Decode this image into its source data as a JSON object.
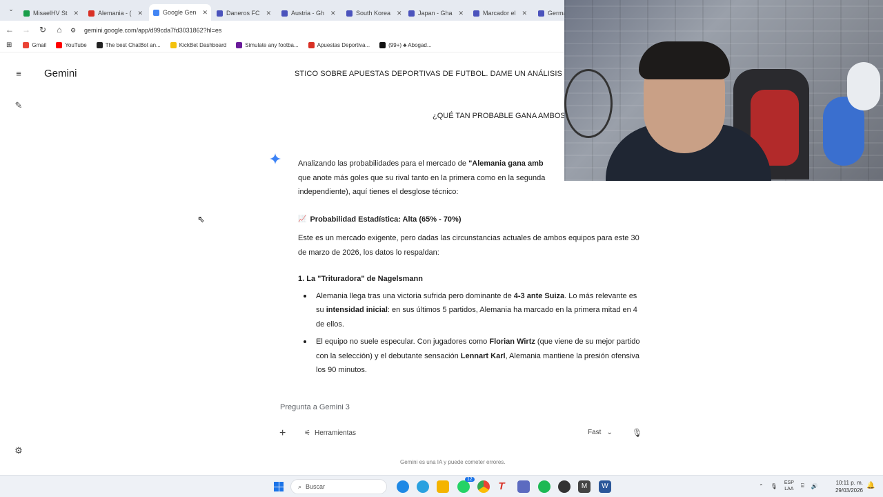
{
  "browser": {
    "tabs": [
      {
        "label": "MisaelHV St",
        "color": "#1a9e4a"
      },
      {
        "label": "Alemania - (",
        "color": "#d93025"
      },
      {
        "label": "Google Gen",
        "color": "#4285f4",
        "active": true
      },
      {
        "label": "Daneros FC",
        "color": "#4b53bc"
      },
      {
        "label": "Austria - Gh",
        "color": "#4b53bc"
      },
      {
        "label": "South Korea",
        "color": "#4b53bc"
      },
      {
        "label": "Japan - Gha",
        "color": "#4b53bc"
      },
      {
        "label": "Marcador el",
        "color": "#4b53bc"
      },
      {
        "label": "Germany",
        "color": "#4b53bc"
      }
    ],
    "url": "gemini.google.com/app/d99cda7fd3031862?hl=es",
    "bookmarks": [
      {
        "label": "Gmail",
        "color": "#ea4335"
      },
      {
        "label": "YouTube",
        "color": "#ff0000"
      },
      {
        "label": "The best ChatBot an...",
        "color": "#222222"
      },
      {
        "label": "KickBet Dashboard",
        "color": "#f4c20d"
      },
      {
        "label": "Simulate any footba...",
        "color": "#6a1b9a"
      },
      {
        "label": "Apuestas Deportiva...",
        "color": "#d93025"
      },
      {
        "label": "(99+) ♣ Abogad...",
        "color": "#111111"
      }
    ]
  },
  "app": {
    "brand": "Gemini"
  },
  "conversation": {
    "user_prompt_1": "STICO SOBRE APUESTAS DEPORTIVAS DE FUTBOL. DAME UN ANÁLISIS",
    "user_prompt_2": "¿QUÉ TAN PROBABLE GANA AMBOS",
    "response": {
      "intro_a": "Analizando las probabilidades para el mercado de ",
      "intro_b": "\"Alemania gana amb",
      "intro_c": "que anote más goles que su rival tanto en la primera como en la segunda",
      "intro_d": "independiente), aquí tienes el desglose técnico:",
      "stat_icon": "📈",
      "stat_heading": "Probabilidad Estadística: Alta (65% - 70%)",
      "para2": "Este es un mercado exigente, pero dadas las circunstancias actuales de ambos equipos para este 30 de marzo de 2026, los datos lo respaldan:",
      "section1": "1. La \"Trituradora\" de Nagelsmann",
      "b1_a": "Alemania llega tras una victoria sufrida pero dominante de ",
      "b1_b": "4-3 ante Suiza",
      "b1_c": ". Lo más relevante es su ",
      "b1_d": "intensidad inicial",
      "b1_e": ": en sus últimos 5 partidos, Alemania ha marcado en la primera mitad en 4 de ellos.",
      "b2_a": "El equipo no suele especular. Con jugadores como ",
      "b2_b": "Florian Wirtz",
      "b2_c": " (que viene de su mejor partido con la selección) y el debutante sensación ",
      "b2_d": "Lennart Karl",
      "b2_e": ", Alemania mantiene la presión ofensiva los 90 minutos."
    }
  },
  "input": {
    "placeholder": "Pregunta a Gemini 3",
    "tools_label": "Herramientas",
    "model_label": "Fast",
    "disclaimer": "Gemini es una IA y puede cometer errores."
  },
  "taskbar": {
    "search_placeholder": "Buscar",
    "lang_1": "ESP",
    "lang_2": "LAA",
    "time": "10:11 p. m.",
    "date": "29/03/2026",
    "badge": "12"
  }
}
